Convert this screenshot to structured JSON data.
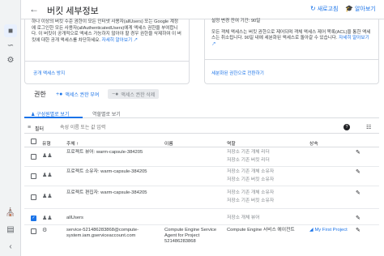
{
  "header": {
    "title": "버킷 세부정보",
    "refresh_label": "새로고침",
    "learn_label": "알아보기"
  },
  "cards": {
    "left": {
      "text": "하나 이상의 버킷 수준 권한이 모든 인터넷 사용자(allUsers) 또는 Google 계정에 로그인한 모든 사용자(allAuthenticatedUsers)에게 액세스 권한을 부여합니다. 이 버킷이 공개적으로 액세스 가능하지 않아야 할 경우 권한을 삭제하여 이 버킷에 대한 공개 액세스를 차단하세요.",
      "learn_more": "자세히 알아보기",
      "footer_link": "공개 액세스 방지"
    },
    "right": {
      "line1": "설정 변경 잔여 기간: 90일",
      "text": "모든 객체 액세스는 버킷 권한으로 제어되며 객체 액세스 제어 목록(ACL)을 통한 액세스는 취소됩니다. 90일 내에 세분화된 액세스로 돌아갈 수 있습니다.",
      "learn_more": "자세히 알아보기",
      "footer_link": "세분화된 권한으로 전환하기"
    }
  },
  "permissions": {
    "title": "권한",
    "grant_label": "액세스 권한 부여",
    "remove_label": "액세스 권한 삭제"
  },
  "tabs": [
    {
      "label": "구성원별로 보기"
    },
    {
      "label": "역할별로 보기"
    }
  ],
  "filter": {
    "label": "필터",
    "placeholder": "속성 이름 또는 값 입력"
  },
  "table": {
    "headers": {
      "type": "유형",
      "principal": "주체",
      "name": "이름",
      "role": "역할",
      "inherited": "상속"
    },
    "rows": [
      {
        "principal": "프로젝트 뷰어: warm-capsule-384205",
        "name": "",
        "role": [
          "저장소 기존 개체 리더",
          "저장소 기존 버킷 리더"
        ],
        "inherited": ""
      },
      {
        "principal": "프로젝트 소유자: warm-capsule-384205",
        "name": "",
        "role": [
          "저장소 기존 개체 소유자",
          "저장소 기존 버킷 소유자"
        ],
        "inherited": ""
      },
      {
        "principal": "프로젝트 편집자: warm-capsule-384205",
        "name": "",
        "role": [
          "저장소 기존 개체 소유자",
          "저장소 기존 버킷 소유자"
        ],
        "inherited": ""
      },
      {
        "principal": "allUsers",
        "name": "",
        "role": [
          "저장소 개체 뷰어"
        ],
        "inherited": ""
      },
      {
        "principal": "service-521486283868@compute-system.iam.gserviceaccount.com",
        "name": "Compute Engine Service Agent for Project 521486283868",
        "role": [
          "Compute Engine 서비스 에이전트"
        ],
        "inherited": "My First Project"
      }
    ]
  }
}
